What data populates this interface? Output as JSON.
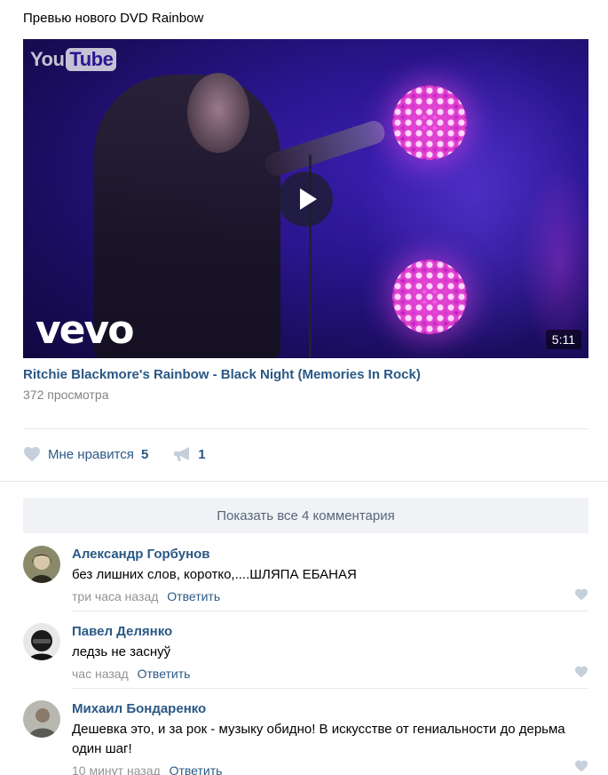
{
  "post": {
    "text": "Превью нового DVD Rainbow"
  },
  "video": {
    "platform_logo_left": "You",
    "platform_logo_right": "Tube",
    "brand_logo": "vevo",
    "duration": "5:11",
    "title": "Ritchie Blackmore's Rainbow - Black Night (Memories In Rock)",
    "views": "372 просмотра"
  },
  "actions": {
    "like_icon": "heart-icon",
    "like_label": "Мне нравится",
    "like_count": "5",
    "share_icon": "megaphone-icon",
    "share_count": "1"
  },
  "comments_section": {
    "show_all_label": "Показать все 4 комментария",
    "items": [
      {
        "author": "Александр Горбунов",
        "text": "без лишних слов, коротко,....ШЛЯПА ЕБАНАЯ",
        "time": "три часа назад",
        "reply_label": "Ответить"
      },
      {
        "author": "Павел Делянко",
        "text": "ледзь не заснуў",
        "time": "час назад",
        "reply_label": "Ответить"
      },
      {
        "author": "Михаил Бондаренко",
        "text": "Дешевка это, и за рок - музыку обидно! В искусстве от гениальности до дерьма один шаг!",
        "time": "10 минут назад",
        "reply_label": "Ответить"
      }
    ]
  },
  "colors": {
    "link": "#2a5885",
    "muted": "#939393",
    "separator": "#e7e8ec",
    "button_bg": "#f0f2f5",
    "icon": "#c5d0db"
  }
}
